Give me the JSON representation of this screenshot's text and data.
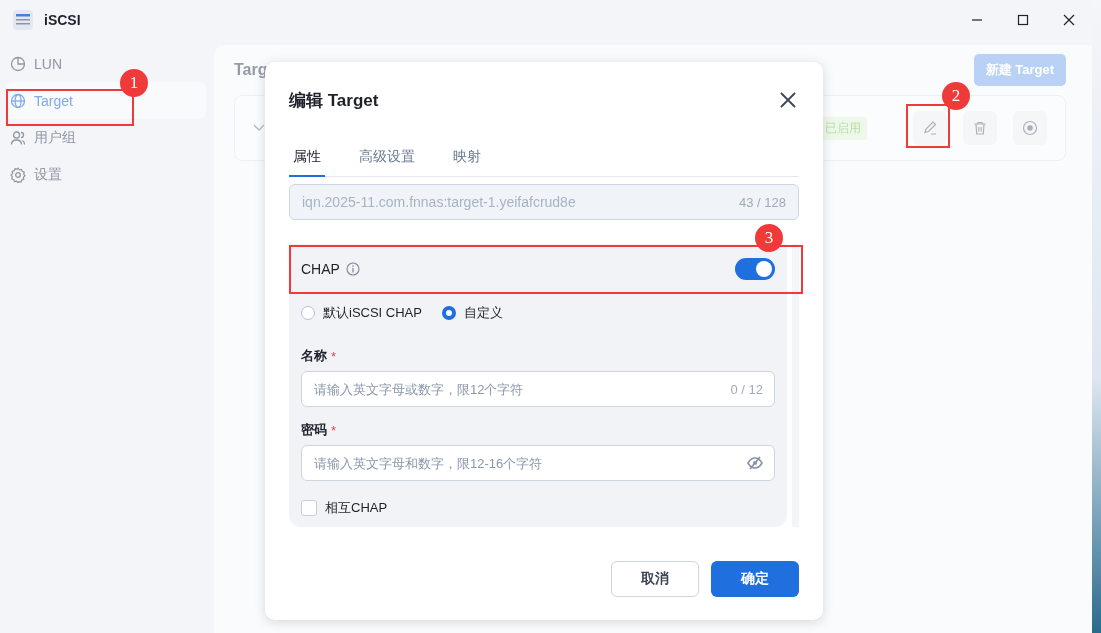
{
  "window": {
    "title": "iSCSI"
  },
  "sidebar": {
    "items": [
      {
        "label": "LUN",
        "selected": false
      },
      {
        "label": "Target",
        "selected": true
      },
      {
        "label": "用户组",
        "selected": false
      },
      {
        "label": "设置",
        "selected": false
      }
    ]
  },
  "main": {
    "heading": "Targ",
    "new_button": "新建 Target",
    "row": {
      "expanded": false,
      "status": "已启用"
    }
  },
  "dialog": {
    "title": "编辑 Target",
    "tabs": [
      {
        "label": "属性",
        "selected": true
      },
      {
        "label": "高级设置",
        "selected": false
      },
      {
        "label": "映射",
        "selected": false
      }
    ],
    "iqn": {
      "value": "iqn.2025-11.com.fnnas:target-1.yeifafcrud8e",
      "counter": "43 / 128",
      "disabled": true
    },
    "chap": {
      "label": "CHAP",
      "on": true,
      "modes": [
        {
          "label": "默认iSCSI CHAP",
          "selected": false
        },
        {
          "label": "自定义",
          "selected": true
        }
      ],
      "name": {
        "label": "名称",
        "required_mark": "*",
        "placeholder": "请输入英文字母或数字，限12个字符",
        "counter": "0 / 12"
      },
      "password": {
        "label": "密码",
        "required_mark": "*",
        "placeholder": "请输入英文字母和数字，限12-16个字符"
      },
      "mutual": {
        "label": "相互CHAP",
        "checked": false
      }
    },
    "buttons": [
      {
        "label": "取消",
        "kind": "secondary"
      },
      {
        "label": "确定",
        "kind": "primary"
      }
    ]
  },
  "annotations": [
    {
      "label": "1"
    },
    {
      "label": "2"
    },
    {
      "label": "3"
    }
  ]
}
